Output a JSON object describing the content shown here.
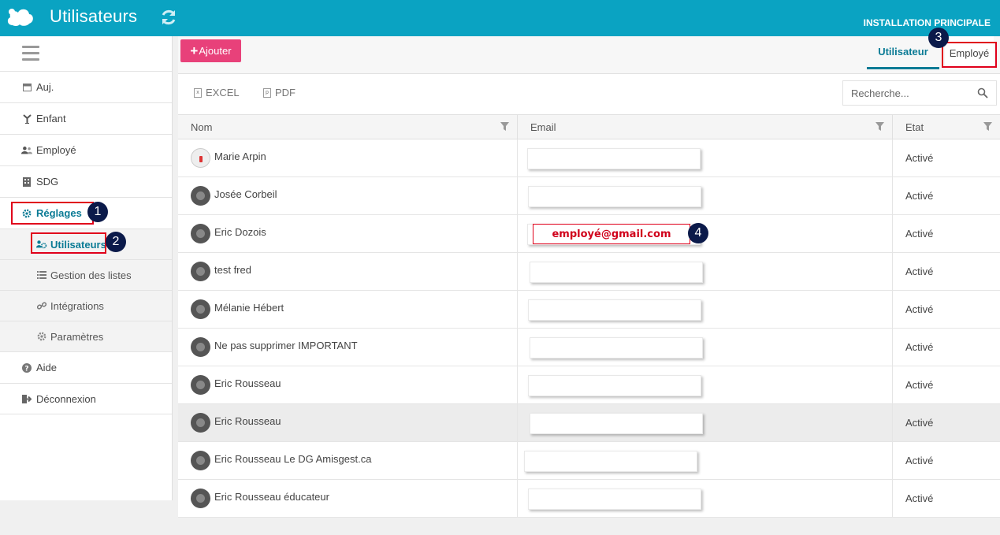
{
  "header": {
    "title": "Utilisateurs",
    "installation": "INSTALLATION PRINCIPALE",
    "logo_icon": "cloud-logo-icon",
    "refresh_icon": "refresh-icon",
    "color": "#0aa3c2"
  },
  "sidebar": {
    "items": [
      {
        "label": "Auj.",
        "icon": "calendar-icon"
      },
      {
        "label": "Enfant",
        "icon": "child-icon"
      },
      {
        "label": "Employé",
        "icon": "users-icon"
      },
      {
        "label": "SDG",
        "icon": "building-icon"
      },
      {
        "label": "Réglages",
        "icon": "gear-icon"
      },
      {
        "label": "Aide",
        "icon": "help-icon"
      },
      {
        "label": "Déconnexion",
        "icon": "logout-icon"
      }
    ],
    "subitems": [
      {
        "label": "Utilisateurs",
        "icon": "users-gear-icon"
      },
      {
        "label": "Gestion des listes",
        "icon": "list-icon"
      },
      {
        "label": "Intégrations",
        "icon": "link-icon"
      },
      {
        "label": "Paramètres",
        "icon": "gear-icon"
      }
    ]
  },
  "toolbar": {
    "add_label": "Ajouter",
    "tab_user": "Utilisateur",
    "tab_employee": "Employé",
    "add_color": "#e8417a"
  },
  "export": {
    "excel": "EXCEL",
    "pdf": "PDF"
  },
  "search": {
    "placeholder": "Recherche..."
  },
  "table": {
    "columns": [
      "Nom",
      "Email",
      "Etat"
    ],
    "rows": [
      {
        "name": "Marie Arpin",
        "status": "Activé"
      },
      {
        "name": "Josée Corbeil",
        "status": "Activé"
      },
      {
        "name": "Eric Dozois",
        "status": "Activé"
      },
      {
        "name": "test fred",
        "status": "Activé"
      },
      {
        "name": "Mélanie Hébert",
        "status": "Activé"
      },
      {
        "name": "Ne pas supprimer IMPORTANT",
        "status": "Activé"
      },
      {
        "name": "Eric Rousseau",
        "status": "Activé"
      },
      {
        "name": "Eric Rousseau",
        "status": "Activé"
      },
      {
        "name": "Eric Rousseau Le DG Amisgest.ca",
        "status": "Activé"
      },
      {
        "name": "Eric Rousseau éducateur",
        "status": "Activé"
      }
    ]
  },
  "annotations": {
    "email_example": "employé@gmail.com",
    "n1": "1",
    "n2": "2",
    "n3": "3",
    "n4": "4",
    "highlight_color": "#e0001b"
  }
}
